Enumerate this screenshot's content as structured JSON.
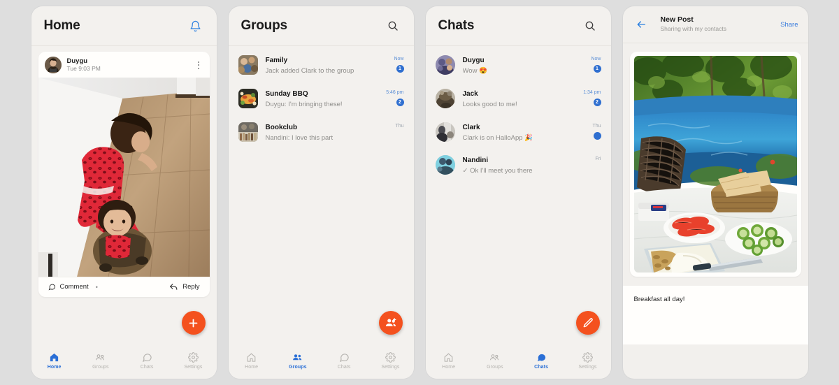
{
  "theme": {
    "page_bg": "#dedede",
    "panel_bg": "#f3f1ee",
    "card_bg": "#fffefc",
    "accent_orange": "#f4511e",
    "accent_blue": "#2a6fd6",
    "badge_blue": "#2f6fd0",
    "muted_text": "#8e8d8a",
    "title_text": "#161616"
  },
  "screens": {
    "home": {
      "header": {
        "title": "Home",
        "bell_icon": "bell-icon"
      },
      "post": {
        "author": "Duygu",
        "timestamp": "Tue 9:03 PM",
        "menu_icon": "kebab-menu-icon",
        "photo_alt": "two-children-in-red-pajamas-hallway",
        "comment_label": "Comment",
        "comment_dot": "•",
        "comment_icon": "comment-icon",
        "reply_label": "Reply",
        "reply_icon": "reply-icon"
      },
      "fab": {
        "icon": "plus-icon",
        "label": "New post"
      }
    },
    "groups": {
      "header": {
        "title": "Groups",
        "search_icon": "search-icon"
      },
      "items": [
        {
          "name": "Family",
          "preview": "Jack added Clark to the group",
          "time": "Now",
          "time_is_blue": true,
          "badge": "1",
          "avatar": "group-photo-family"
        },
        {
          "name": "Sunday BBQ",
          "preview": "Duygu: I'm bringing these!",
          "time": "5:46 pm",
          "time_is_blue": true,
          "badge": "2",
          "avatar": "group-photo-bbq"
        },
        {
          "name": "Bookclub",
          "preview": "Nandini: I love this part",
          "time": "Thu",
          "time_is_blue": false,
          "badge": "",
          "avatar": "group-photo-bookclub"
        }
      ],
      "fab": {
        "icon": "add-group-icon",
        "label": "New group"
      }
    },
    "chats": {
      "header": {
        "title": "Chats",
        "search_icon": "search-icon"
      },
      "items": [
        {
          "name": "Duygu",
          "preview": "Wow 😍",
          "time": "Now",
          "time_is_blue": true,
          "badge": "1",
          "avatar": "contact-photo-duygu"
        },
        {
          "name": "Jack",
          "preview": "Looks good to me!",
          "time": "1:34 pm",
          "time_is_blue": true,
          "badge": "2",
          "avatar": "contact-photo-jack"
        },
        {
          "name": "Clark",
          "preview": "Clark is on HalloApp 🎉",
          "time": "Thu",
          "time_is_blue": false,
          "badge": "",
          "avatar": "contact-photo-clark"
        },
        {
          "name": "Nandini",
          "preview": "✓ Ok I'll meet you there",
          "time": "Fri",
          "time_is_blue": false,
          "badge": null,
          "avatar": "contact-photo-nandini"
        }
      ],
      "fab": {
        "icon": "pencil-icon",
        "label": "New chat"
      }
    },
    "new_post": {
      "header": {
        "back_icon": "back-arrow-icon",
        "title": "New Post",
        "subtitle": "Sharing with my contacts",
        "share_label": "Share"
      },
      "photo_alt": "backyard-pool-breakfast-table",
      "caption": "Breakfast all day!"
    }
  },
  "bottom_nav": {
    "items": [
      {
        "label": "Home",
        "icon": "home-icon"
      },
      {
        "label": "Groups",
        "icon": "groups-icon"
      },
      {
        "label": "Chats",
        "icon": "chats-icon"
      },
      {
        "label": "Settings",
        "icon": "settings-gear-icon"
      }
    ],
    "active_index": {
      "home": 0,
      "groups": 1,
      "chats": 2
    }
  }
}
